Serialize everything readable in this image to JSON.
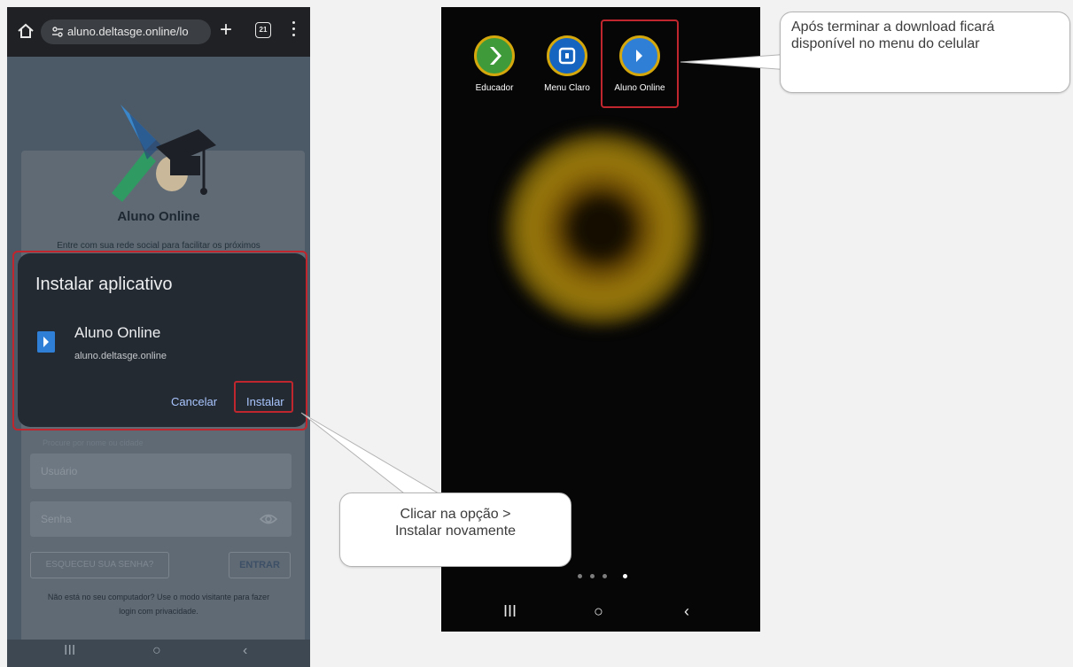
{
  "browser": {
    "url": "aluno.deltasge.online/lo",
    "tab_count": "21"
  },
  "login_page": {
    "title": "Aluno Online",
    "intro": "Entre com sua rede social para facilitar os próximos",
    "search_hint": "Procure por nome ou cidade",
    "username_label": "Usuário",
    "password_label": "Senha",
    "forgot_button": "ESQUECEU SUA SENHA?",
    "enter_button": "ENTRAR",
    "footer_line1": "Não está no seu computador? Use o modo visitante para fazer",
    "footer_line2": "login com privacidade."
  },
  "install_dialog": {
    "title": "Instalar aplicativo",
    "app_name": "Aluno Online",
    "app_url": "aluno.deltasge.online",
    "cancel_label": "Cancelar",
    "install_label": "Instalar"
  },
  "home_screen": {
    "apps": [
      {
        "label": "Educador",
        "color": "#3f9b3a"
      },
      {
        "label": "Menu Claro",
        "color": "#1565c0"
      },
      {
        "label": "Aluno Online",
        "color": "#2f7fd6"
      }
    ],
    "page_count": 4,
    "active_page": 4
  },
  "callouts": {
    "top": "Após terminar a download ficará disponível no menu do celular",
    "bottom_line1": "Clicar na opção >",
    "bottom_line2": "Instalar novamente"
  },
  "colors": {
    "highlight": "#c0262d",
    "dialog_bg": "#242a32",
    "accent_link": "#a9c6ff"
  }
}
